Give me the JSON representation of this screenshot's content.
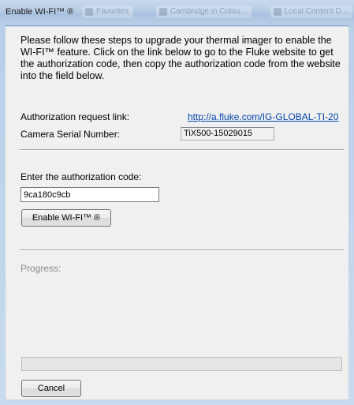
{
  "window": {
    "title": "Enable WI-FI™ ®",
    "background_tabs": [
      "Favorites",
      "Cambridge in Colou...",
      "Local Content D..."
    ]
  },
  "intro_text": "Please follow these steps to upgrade your thermal imager to enable the WI-FI™ feature.  Click on the link below to go to the Fluke website to get the authorization code, then copy the authorization code from the website into the field below.",
  "authorization": {
    "label": "Authorization request link:",
    "link_text": "http://a.fluke.com/IG-GLOBAL-TI-20"
  },
  "camera": {
    "label": "Camera Serial Number:",
    "serial": "TiX500-15029015"
  },
  "auth_code": {
    "label": "Enter the authorization code:",
    "value": "9ca180c9cb"
  },
  "buttons": {
    "enable_label": "Enable WI-FI™ ®",
    "cancel_label": "Cancel"
  },
  "progress": {
    "label": "Progress:",
    "value": 0
  },
  "colors": {
    "link": "#0645ad",
    "disabled_text": "#8a8a8a"
  }
}
